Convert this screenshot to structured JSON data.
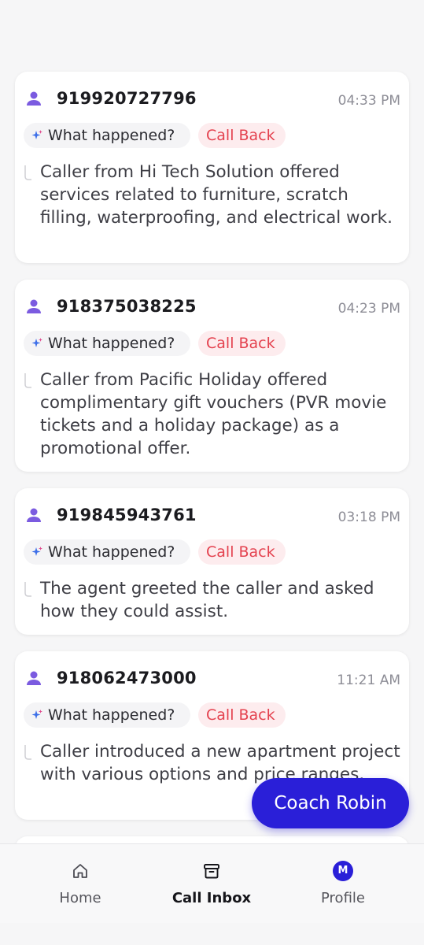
{
  "calls": [
    {
      "phone": "919920727796",
      "time": "04:33 PM",
      "what_label": "What happened?",
      "tag_label": "Call Back",
      "summary": "Caller from Hi Tech Solution offered services related to furniture, scratch filling, waterproofing, and electrical work."
    },
    {
      "phone": "918375038225",
      "time": "04:23 PM",
      "what_label": "What happened?",
      "tag_label": "Call Back",
      "summary": "Caller from Pacific Holiday offered complimentary gift vouchers (PVR movie tickets and a holiday package) as a promotional offer."
    },
    {
      "phone": "919845943761",
      "time": "03:18 PM",
      "what_label": "What happened?",
      "tag_label": "Call Back",
      "summary": "The agent greeted the caller and asked how they could assist."
    },
    {
      "phone": "918062473000",
      "time": "11:21 AM",
      "what_label": "What happened?",
      "tag_label": "Call Back",
      "summary": "Caller introduced a new apartment project with various options and price ranges."
    }
  ],
  "coach_button": {
    "label": "Coach Robin"
  },
  "nav": {
    "home": "Home",
    "inbox": "Call Inbox",
    "profile": "Profile",
    "profile_initial": "M"
  },
  "icons": {
    "avatar": "user-icon",
    "sparkle": "sparkle-icon",
    "call_line": "call-line-icon",
    "home": "home-icon",
    "inbox": "archive-box-icon"
  },
  "colors": {
    "accent": "#2a1fd8",
    "avatar": "#7b5be0",
    "callback_text": "#e4424f",
    "callback_bg": "#fdecee"
  }
}
